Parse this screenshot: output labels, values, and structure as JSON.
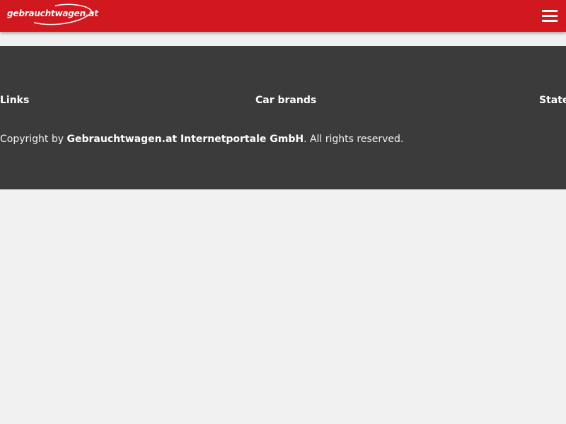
{
  "header": {
    "logo_text": "gebrauchtwagen.at",
    "menu_icon": "hamburger-menu-icon",
    "brand_color": "#d0181e"
  },
  "footer": {
    "background_color": "#3b3b3b",
    "columns": [
      {
        "label": "Links"
      },
      {
        "label": "Car brands"
      },
      {
        "label": "State"
      }
    ],
    "copyright": {
      "prefix": "Copyright by ",
      "company": "Gebrauchtwagen.at Internetportale GmbH",
      "suffix": ". All rights reserved."
    }
  }
}
